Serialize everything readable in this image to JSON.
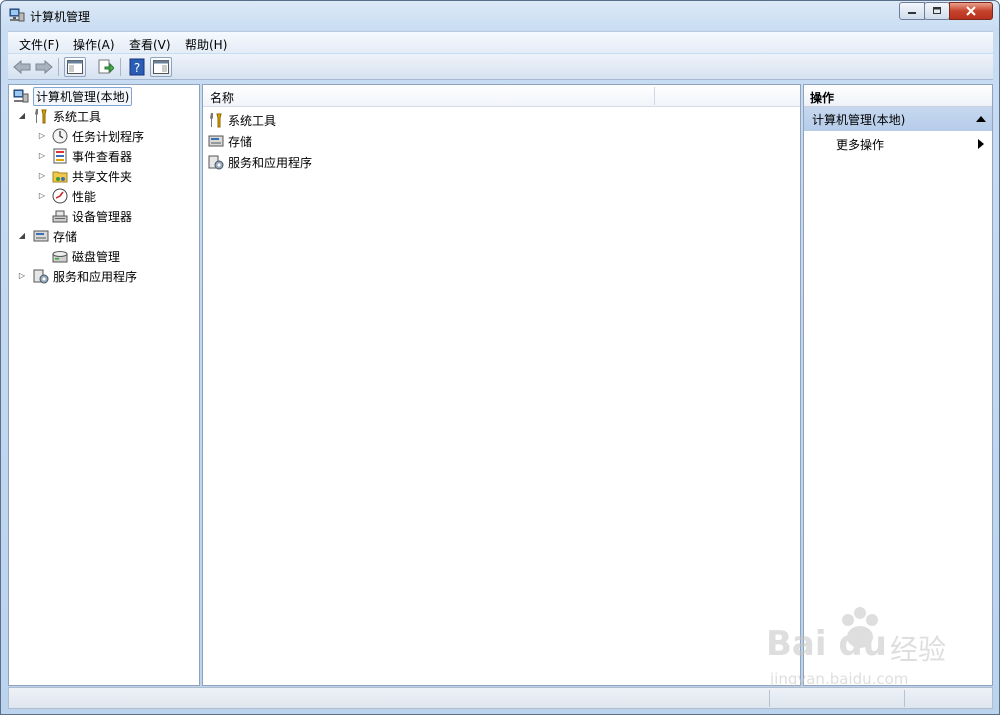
{
  "window": {
    "title": "计算机管理"
  },
  "menu": [
    {
      "label": "文件(F)"
    },
    {
      "label": "操作(A)"
    },
    {
      "label": "查看(V)"
    },
    {
      "label": "帮助(H)"
    }
  ],
  "tree": {
    "root": "计算机管理(本地)",
    "system_tools": "系统工具",
    "task_scheduler": "任务计划程序",
    "event_viewer": "事件查看器",
    "shared_folders": "共享文件夹",
    "performance": "性能",
    "device_manager": "设备管理器",
    "storage": "存储",
    "disk_management": "磁盘管理",
    "services_apps": "服务和应用程序"
  },
  "list": {
    "column_name": "名称",
    "items": [
      "系统工具",
      "存储",
      "服务和应用程序"
    ]
  },
  "actions": {
    "title": "操作",
    "section": "计算机管理(本地)",
    "more": "更多操作"
  },
  "watermark": {
    "brand": "Bai du",
    "brand_cn": "经验",
    "url": "jingyan.baidu.com"
  },
  "colors": {
    "accent": "#b6cce9",
    "titlebar": "#c8dcf2",
    "close": "#c7432c"
  }
}
